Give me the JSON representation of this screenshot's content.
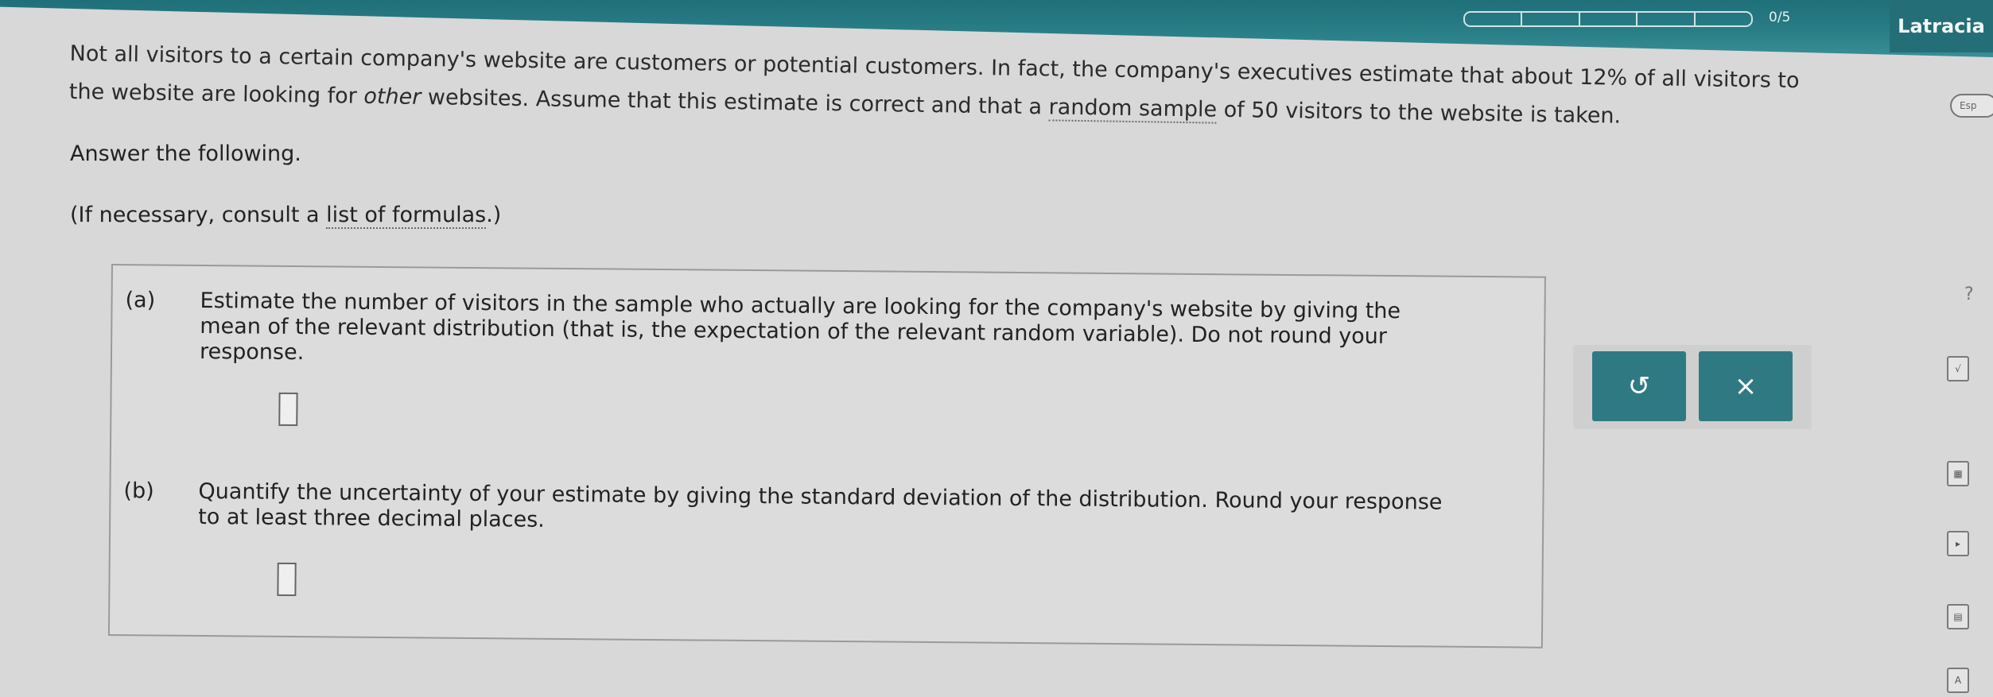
{
  "header": {
    "score": "0/5",
    "user_name": "Latracia",
    "progress_segments": 5,
    "lang_button": "Esp"
  },
  "problem": {
    "intro_line1_a": "Not all visitors to a certain company's website are customers or potential customers. In fact, the company's executives estimate that about 12% of all visitors to",
    "intro_line2_a": "the website are looking for ",
    "intro_line2_em": "other",
    "intro_line2_b": " websites. Assume that this estimate is correct and that a ",
    "intro_line2_link": "random sample",
    "intro_line2_c": " of 50 visitors to the website is taken.",
    "answer_following": "Answer the following.",
    "consult_prefix": "(If necessary, consult a ",
    "consult_link": "list of formulas",
    "consult_suffix": ".)"
  },
  "parts": {
    "a_label": "(a)",
    "a_line1": "Estimate the number of visitors in the sample who actually are looking for the company's website by giving the",
    "a_line2": "mean of the relevant distribution (that is, the expectation of the relevant random variable). Do not round your",
    "a_line3": "response.",
    "b_label": "(b)",
    "b_line1": "Quantify the uncertainty of your estimate by giving the standard deviation of the distribution. Round your response",
    "b_line2": "to at least three decimal places."
  },
  "tools": {
    "undo_icon": "↺",
    "clear_icon": "×"
  },
  "side": {
    "help_icon": "?"
  },
  "colors": {
    "accent": "#2f7a82",
    "header": "#1f6f78"
  }
}
